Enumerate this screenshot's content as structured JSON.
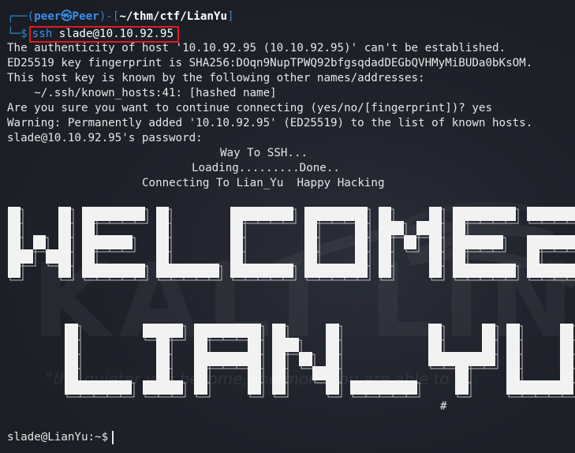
{
  "prompt": {
    "user": "peer",
    "symbol": "㉿",
    "host": "Peer",
    "path": "~/thm/ctf/LianYu",
    "command_name": "ssh",
    "command_arg": "slade@10.10.92.95"
  },
  "output_lines": [
    "The authenticity of host '10.10.92.95 (10.10.92.95)' can't be established.",
    "ED25519 key fingerprint is SHA256:DOqn9NupTPWQ92bfgsqdadDEGbQVHMyMiBUDa0bKsOM.",
    "This host key is known by the following other names/addresses:",
    "    ~/.ssh/known_hosts:41: [hashed name]",
    "Are you sure you want to continue connecting (yes/no/[fingerprint])? yes",
    "Warning: Permanently added '10.10.92.95' (ED25519) to the list of known hosts.",
    "slade@10.10.92.95's password:"
  ],
  "banner_lines": [
    "Way To SSH...",
    "Loading.........Done..",
    "Connecting To Lian_Yu  Happy Hacking"
  ],
  "ascii_art": {
    "line1": "WELCOME2",
    "line2": "LIAN_YU",
    "colors": {
      "fill": "#f2f2f2",
      "shadow": "#d8d8d8"
    }
  },
  "hash_symbol": "#",
  "final_prompt": "slade@LianYu:~$",
  "wallpaper": {
    "quote": "\"the quieter you become, the more you are able to"
  },
  "colors": {
    "background": "#1c1f26",
    "prompt_blue": "#2f89c7",
    "highlight_red": "#e01a22",
    "text": "#e6e6e6"
  }
}
